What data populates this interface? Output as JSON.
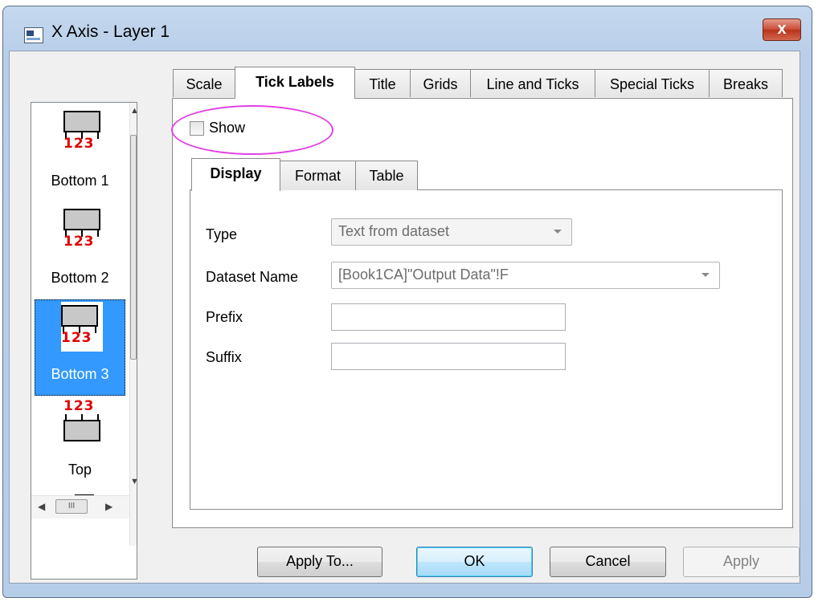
{
  "window": {
    "title": "X Axis - Layer 1",
    "close_glyph": "x"
  },
  "sidebar": {
    "items": [
      {
        "label": "Bottom 1",
        "icon": "axis-bottom-icon",
        "numbers": "123",
        "selected": false
      },
      {
        "label": "Bottom 2",
        "icon": "axis-bottom-icon",
        "numbers": "123",
        "selected": false
      },
      {
        "label": "Bottom 3",
        "icon": "axis-bottom-icon",
        "numbers": "123",
        "selected": true
      },
      {
        "label": "Top",
        "icon": "axis-top-icon",
        "numbers": "123",
        "selected": false
      }
    ],
    "hscroll_thumb": "III"
  },
  "tabs": [
    {
      "label": "Scale",
      "active": false
    },
    {
      "label": "Tick Labels",
      "active": true
    },
    {
      "label": "Title",
      "active": false
    },
    {
      "label": "Grids",
      "active": false
    },
    {
      "label": "Line and Ticks",
      "active": false
    },
    {
      "label": "Special Ticks",
      "active": false
    },
    {
      "label": "Breaks",
      "active": false
    }
  ],
  "show": {
    "label": "Show",
    "checked": false
  },
  "subtabs": [
    {
      "label": "Display",
      "active": true
    },
    {
      "label": "Format",
      "active": false
    },
    {
      "label": "Table",
      "active": false
    }
  ],
  "form": {
    "type_label": "Type",
    "type_value": "Text from dataset",
    "dataset_label": "Dataset Name",
    "dataset_value": "[Book1CA]\"Output Data\"!F",
    "prefix_label": "Prefix",
    "prefix_value": "",
    "suffix_label": "Suffix",
    "suffix_value": ""
  },
  "buttons": {
    "apply_to": "Apply To...",
    "ok": "OK",
    "cancel": "Cancel",
    "apply": "Apply"
  },
  "colors": {
    "selection": "#3399ff",
    "highlight_ring": "#e23fe2",
    "tick_numbers": "#e00000"
  }
}
